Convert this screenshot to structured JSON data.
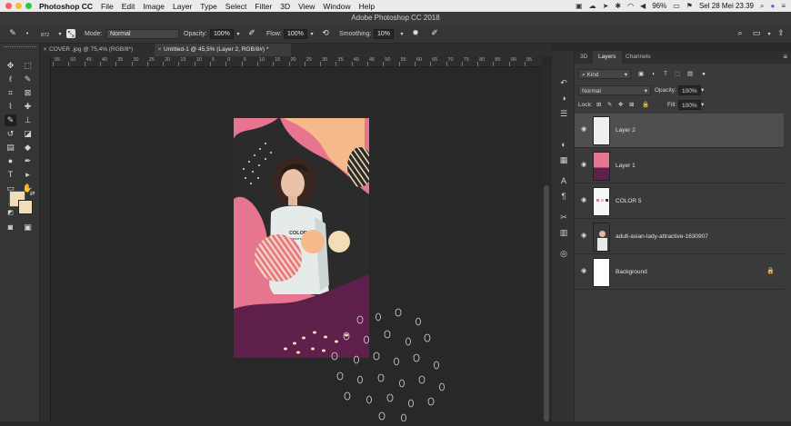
{
  "menubar": {
    "app_name": "Photoshop CC",
    "items": [
      "File",
      "Edit",
      "Image",
      "Layer",
      "Type",
      "Select",
      "Filter",
      "3D",
      "View",
      "Window",
      "Help"
    ],
    "battery": "96%",
    "clock": "Sel 28 Mei  23.39"
  },
  "window": {
    "title": "Adobe Photoshop CC 2018"
  },
  "options": {
    "brush_size": "872",
    "mode_label": "Mode:",
    "mode_value": "Normal",
    "opacity_label": "Opacity:",
    "opacity_value": "100%",
    "flow_label": "Flow:",
    "flow_value": "100%",
    "smoothing_label": "Smoothing:",
    "smoothing_value": "10%"
  },
  "doc_tabs": [
    {
      "label": "COVER .jpg @ 75,4% (RGB/8*)"
    },
    {
      "label": "Untitled-1 @ 45,5% (Layer 2, RGB/8#) *"
    }
  ],
  "ruler_labels": [
    "55",
    "50",
    "45",
    "40",
    "35",
    "30",
    "25",
    "20",
    "15",
    "10",
    "5",
    "0",
    "5",
    "10",
    "15",
    "20",
    "25",
    "30",
    "35",
    "40",
    "45",
    "50",
    "55",
    "60",
    "65",
    "70",
    "75",
    "80",
    "85",
    "90",
    "95"
  ],
  "canvas": {
    "poster_text_line1": "COLOR 01",
    "poster_text_line2": "FROM SPRING",
    "colors": {
      "pink": "#e8758f",
      "peach": "#f5b98a",
      "plum": "#5e1f4a",
      "cream": "#f3ddb6",
      "dark": "#2a2b2a"
    }
  },
  "panel": {
    "tabs": [
      "3D",
      "Layers",
      "Channels"
    ],
    "active_tab": "Layers",
    "filter_label": "Kind",
    "blend_mode": "Normal",
    "opacity_label": "Opacity:",
    "opacity_value": "100%",
    "lock_label": "Lock:",
    "fill_label": "Fill:",
    "fill_value": "100%",
    "layers": [
      {
        "name": "Layer 2",
        "selected": true
      },
      {
        "name": "Layer 1",
        "selected": false
      },
      {
        "name": "COLOR 5",
        "selected": false
      },
      {
        "name": "adult-asian-lady-attractive-1630907",
        "selected": false
      },
      {
        "name": "Background",
        "selected": false,
        "locked": true
      }
    ]
  },
  "icons": {
    "traffic_lights": [
      "#fc5f57",
      "#fdbc2e",
      "#28c840"
    ]
  }
}
